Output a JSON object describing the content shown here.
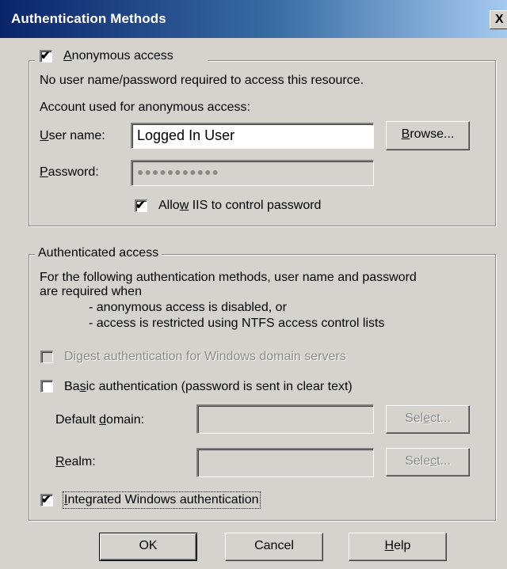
{
  "window": {
    "title": "Authentication Methods",
    "close_glyph": "X"
  },
  "anonymous": {
    "checkbox_label": "Anonymous access",
    "checked": true,
    "description": "No user name/password required to access this resource.",
    "account_caption": "Account used for anonymous access:",
    "username_label": "User name:",
    "username_value": "Logged In User",
    "browse_label": "Browse...",
    "password_label": "Password:",
    "password_mask": "●●●●●●●●●●●",
    "allow_iis_label": "Allow IIS to control password",
    "allow_iis_checked": true
  },
  "authenticated": {
    "legend": "Authenticated access",
    "desc_line1": "For the following authentication methods, user name and password",
    "desc_line2": "are required when",
    "bullet1": "- anonymous access is disabled, or",
    "bullet2": "- access is restricted using NTFS access control lists",
    "digest_label": "Digest authentication for Windows domain servers",
    "digest_checked": false,
    "basic_label": "Basic authentication (password is sent in clear text)",
    "basic_checked": false,
    "default_domain_label": "Default domain:",
    "default_domain_value": "",
    "realm_label": "Realm:",
    "realm_value": "",
    "select_label": "Select...",
    "integrated_label": "Integrated Windows authentication",
    "integrated_checked": true
  },
  "buttons": {
    "ok": "OK",
    "cancel": "Cancel",
    "help": "Help"
  }
}
